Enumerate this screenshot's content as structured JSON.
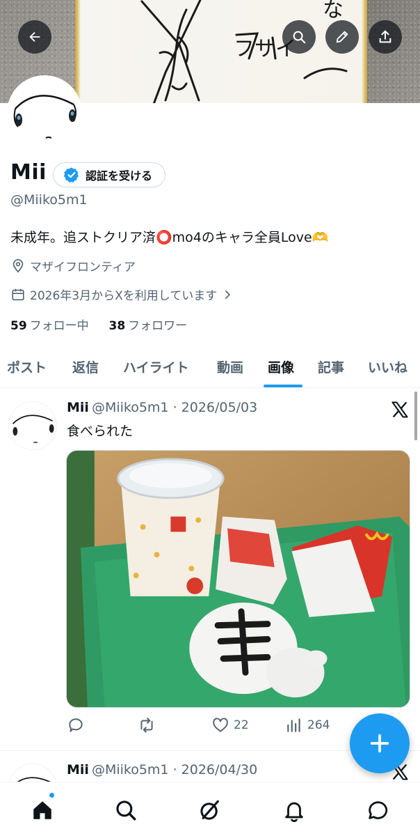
{
  "profile": {
    "name": "Mii",
    "verify_button_label": "認証を受ける",
    "handle": "@Miiko5m1",
    "bio": "未成年。追ストクリア済⭕️mo4のキャラ全員Love🫶",
    "location": "マザイフロンティア",
    "joined": "2026年3月からXを利用しています",
    "following_count": "59",
    "following_label": "フォロー中",
    "followers_count": "38",
    "followers_label": "フォロワー"
  },
  "header": {
    "back_icon": "arrow-left-icon",
    "search_icon": "search-icon",
    "edit_icon": "pencil-icon",
    "share_icon": "share-icon",
    "banner_text": [
      "な",
      "フサイ"
    ]
  },
  "tabs": [
    {
      "label": "ポスト"
    },
    {
      "label": "返信"
    },
    {
      "label": "ハイライト"
    },
    {
      "label": "動画"
    },
    {
      "label": "画像",
      "active": true
    },
    {
      "label": "記事"
    },
    {
      "label": "いいね"
    }
  ],
  "posts": [
    {
      "author": "Mii",
      "handle_date": "@Miiko5m1 · 2026/05/03",
      "text": "食べられた",
      "replies": "",
      "retweets": "",
      "likes": "22",
      "views": "264"
    },
    {
      "author": "Mii",
      "handle_date": "@Miiko5m1 · 2026/04/30"
    }
  ],
  "colors": {
    "accent": "#1d9bf0",
    "text_primary": "#0f1419",
    "text_secondary": "#536471",
    "border": "#eff3f4"
  },
  "bottom_nav": [
    "home-icon",
    "search-icon",
    "grok-icon",
    "notifications-icon",
    "messages-icon"
  ]
}
